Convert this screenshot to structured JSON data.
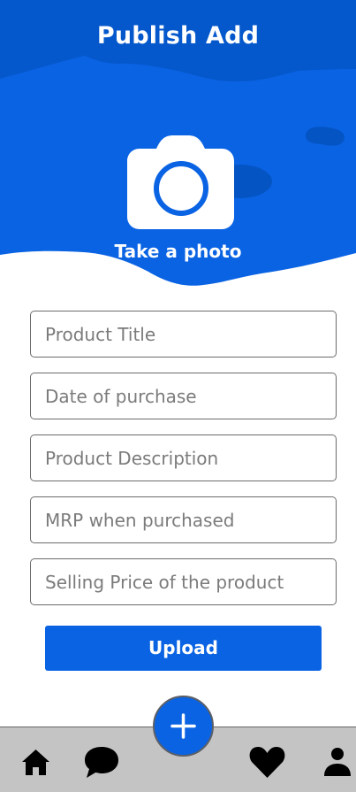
{
  "header": {
    "title": "Publish Add"
  },
  "photo": {
    "label": "Take a photo",
    "icon": "camera-icon"
  },
  "form": {
    "fields": [
      {
        "placeholder": "Product Title",
        "value": ""
      },
      {
        "placeholder": "Date of purchase",
        "value": ""
      },
      {
        "placeholder": "Product Description",
        "value": ""
      },
      {
        "placeholder": "MRP when purchased",
        "value": ""
      },
      {
        "placeholder": "Selling Price of the product",
        "value": ""
      }
    ],
    "upload_label": "Upload"
  },
  "bottom_nav": {
    "items": [
      {
        "icon": "home-icon"
      },
      {
        "icon": "chat-icon"
      },
      {
        "icon": "plus-icon"
      },
      {
        "icon": "heart-icon"
      },
      {
        "icon": "user-icon"
      }
    ]
  },
  "colors": {
    "primary": "#0A63E3",
    "header_dark": "#0558CC",
    "nav_background": "#C4C4C4",
    "field_border": "#6B6B6B"
  }
}
